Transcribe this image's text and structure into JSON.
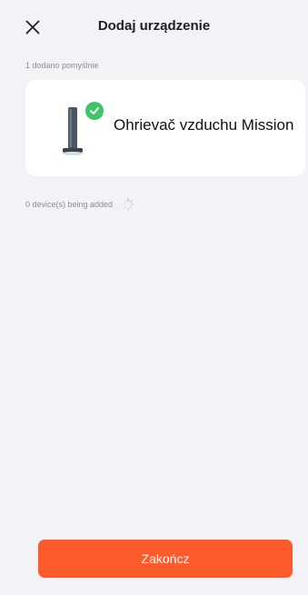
{
  "header": {
    "title": "Dodaj urządzenie",
    "close_icon": "close-icon"
  },
  "status": {
    "success_text": "1 dodano pomyślnie",
    "adding_text": "0 device(s) being added"
  },
  "device": {
    "name": "Ohrievač vzduchu Mission",
    "image_icon": "tower-heater-icon",
    "badge_icon": "check-icon"
  },
  "footer": {
    "finish_label": "Zakończ"
  },
  "colors": {
    "background": "#f3f3f7",
    "card": "#ffffff",
    "accent": "#ff5a2b",
    "success": "#3fc46b",
    "muted_text": "#8a8a92"
  }
}
